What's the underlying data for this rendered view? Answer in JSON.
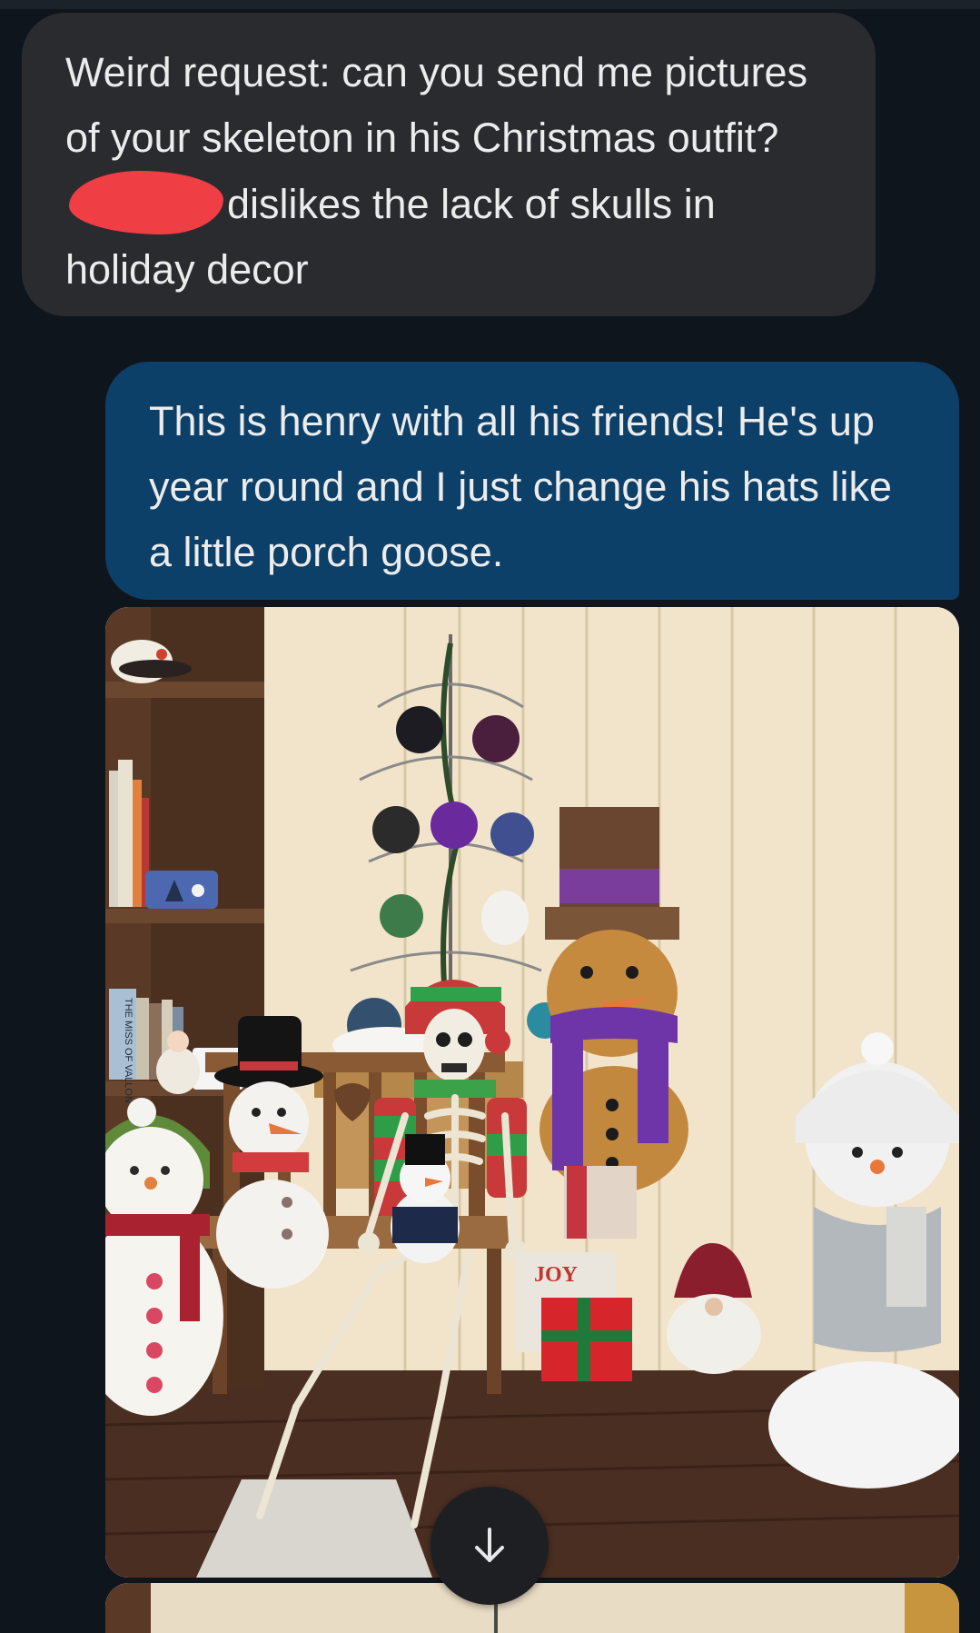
{
  "conversation": {
    "incoming": {
      "text_before_redaction": "Weird request: can you send me pictures of your skeleton in his Christmas outfit?",
      "text_after_redaction": "dislikes the lack of skulls in holiday decor"
    },
    "outgoing": {
      "text": "This is henry with all his friends! He's up year round and I just change his hats like a little porch goose."
    }
  },
  "photo": {
    "gift_box_label": "JOY",
    "bookshelf": {
      "book_spine_text": "THE MISS OF VALLON"
    }
  },
  "controls": {
    "scroll_down_icon": "arrow-down-icon"
  },
  "colors": {
    "background": "#0f151d",
    "incoming_bubble": "#2a2b2f",
    "outgoing_bubble": "#0d4068",
    "text": "#ececec",
    "redaction": "#ef3e44"
  }
}
